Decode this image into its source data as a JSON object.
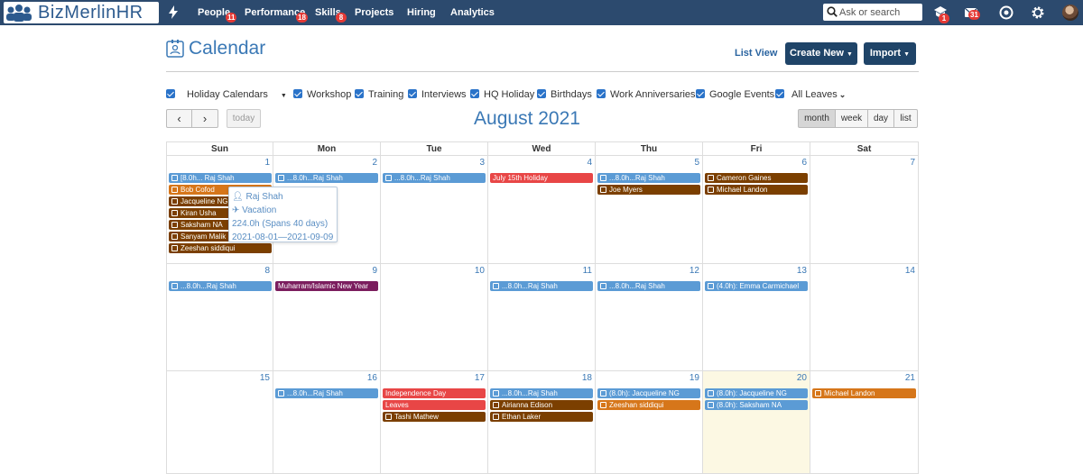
{
  "nav": {
    "logo_text": "BizMerlinHR",
    "items": [
      {
        "label": "People",
        "badge": "11"
      },
      {
        "label": "Performance",
        "badge": "18"
      },
      {
        "label": "Skills",
        "badge": "8"
      },
      {
        "label": "Projects"
      },
      {
        "label": "Hiring"
      },
      {
        "label": "Analytics"
      }
    ],
    "search_placeholder": "Ask or search",
    "notif_badge": "1",
    "mail_badge": "31"
  },
  "page": {
    "title": "Calendar",
    "list_view": "List View",
    "create_new": "Create New",
    "import": "Import"
  },
  "filters": [
    "Holiday Calendars",
    "Workshop",
    "Training",
    "Interviews",
    "HQ Holiday",
    "Birthdays",
    "Work Anniversaries",
    "Google Events",
    "All Leaves"
  ],
  "toolbar": {
    "prev": "‹",
    "next": "›",
    "today": "today",
    "month_title": "August 2021",
    "views": [
      "month",
      "week",
      "day",
      "list"
    ],
    "active_view": "month"
  },
  "weekdays": [
    "Sun",
    "Mon",
    "Tue",
    "Wed",
    "Thu",
    "Fri",
    "Sat"
  ],
  "weeks": [
    {
      "days": [
        {
          "n": "1",
          "events": [
            {
              "t": "[8.0h... Raj Shah",
              "c": "blue",
              "i": "cal"
            },
            {
              "t": "Bob Cofod",
              "c": "orange",
              "i": "thumb"
            },
            {
              "t": "Jacqueline NG",
              "c": "brown",
              "i": "gift"
            },
            {
              "t": "Kiran Usha",
              "c": "brown",
              "i": "gift"
            },
            {
              "t": "Saksham NA",
              "c": "brown",
              "i": "gift"
            },
            {
              "t": "Sanyam Malik",
              "c": "brown",
              "i": "gift"
            },
            {
              "t": "Zeeshan siddiqui",
              "c": "brown",
              "i": "gift"
            }
          ]
        },
        {
          "n": "2",
          "events": [
            {
              "t": "...8.0h...Raj Shah",
              "c": "blue",
              "i": "cal"
            }
          ]
        },
        {
          "n": "3",
          "events": [
            {
              "t": "...8.0h...Raj Shah",
              "c": "blue",
              "i": "cal"
            }
          ]
        },
        {
          "n": "4",
          "events": [
            {
              "t": "July 15th Holiday",
              "c": "red",
              "i": ""
            }
          ]
        },
        {
          "n": "5",
          "events": [
            {
              "t": "...8.0h...Raj Shah",
              "c": "blue",
              "i": "cal"
            },
            {
              "t": "Joe Myers",
              "c": "brown",
              "i": "gift"
            }
          ]
        },
        {
          "n": "6",
          "events": [
            {
              "t": "Cameron Gaines",
              "c": "brown",
              "i": "gift"
            },
            {
              "t": "Michael Landon",
              "c": "brown",
              "i": "gift"
            }
          ]
        },
        {
          "n": "7",
          "events": []
        }
      ]
    },
    {
      "days": [
        {
          "n": "8",
          "events": [
            {
              "t": "...8.0h...Raj Shah",
              "c": "blue",
              "i": "cal"
            }
          ]
        },
        {
          "n": "9",
          "events": [
            {
              "t": "Muharram/Islamic New Year",
              "c": "purple",
              "i": ""
            }
          ]
        },
        {
          "n": "10",
          "events": []
        },
        {
          "n": "11",
          "events": [
            {
              "t": "...8.0h...Raj Shah",
              "c": "blue",
              "i": "cal"
            }
          ]
        },
        {
          "n": "12",
          "events": [
            {
              "t": "...8.0h...Raj Shah",
              "c": "blue",
              "i": "cal"
            }
          ]
        },
        {
          "n": "13",
          "events": [
            {
              "t": "(4.0h): Emma Carmichael",
              "c": "blue",
              "i": "cal"
            }
          ]
        },
        {
          "n": "14",
          "events": []
        }
      ]
    },
    {
      "days": [
        {
          "n": "15",
          "events": []
        },
        {
          "n": "16",
          "events": [
            {
              "t": "...8.0h...Raj Shah",
              "c": "blue",
              "i": "cal"
            }
          ]
        },
        {
          "n": "17",
          "events": [
            {
              "t": "Independence Day",
              "c": "red",
              "i": ""
            },
            {
              "t": "Leaves",
              "c": "red",
              "i": ""
            },
            {
              "t": "Tashi Mathew",
              "c": "brown",
              "i": "gift"
            }
          ]
        },
        {
          "n": "18",
          "events": [
            {
              "t": "...8.0h...Raj Shah",
              "c": "blue",
              "i": "cal"
            },
            {
              "t": "Airianna Edison",
              "c": "brown",
              "i": "gift"
            },
            {
              "t": "Ethan Laker",
              "c": "brown",
              "i": "gift"
            }
          ]
        },
        {
          "n": "19",
          "events": [
            {
              "t": "(8.0h): Jacqueline NG",
              "c": "blue",
              "i": "cal"
            },
            {
              "t": "Zeeshan siddiqui",
              "c": "orange",
              "i": "thumb"
            }
          ]
        },
        {
          "n": "20",
          "today": true,
          "events": [
            {
              "t": "(8.0h): Jacqueline NG",
              "c": "blue",
              "i": "cal"
            },
            {
              "t": "(8.0h): Saksham NA",
              "c": "blue",
              "i": "cal"
            }
          ]
        },
        {
          "n": "21",
          "events": [
            {
              "t": "Michael Landon",
              "c": "orange",
              "i": "thumb"
            }
          ]
        }
      ]
    }
  ],
  "popup": {
    "name": "Raj Shah",
    "type": "Vacation",
    "hours": "224.0h (Spans 40 days)",
    "range": "2021-08-01—2021-09-09"
  }
}
